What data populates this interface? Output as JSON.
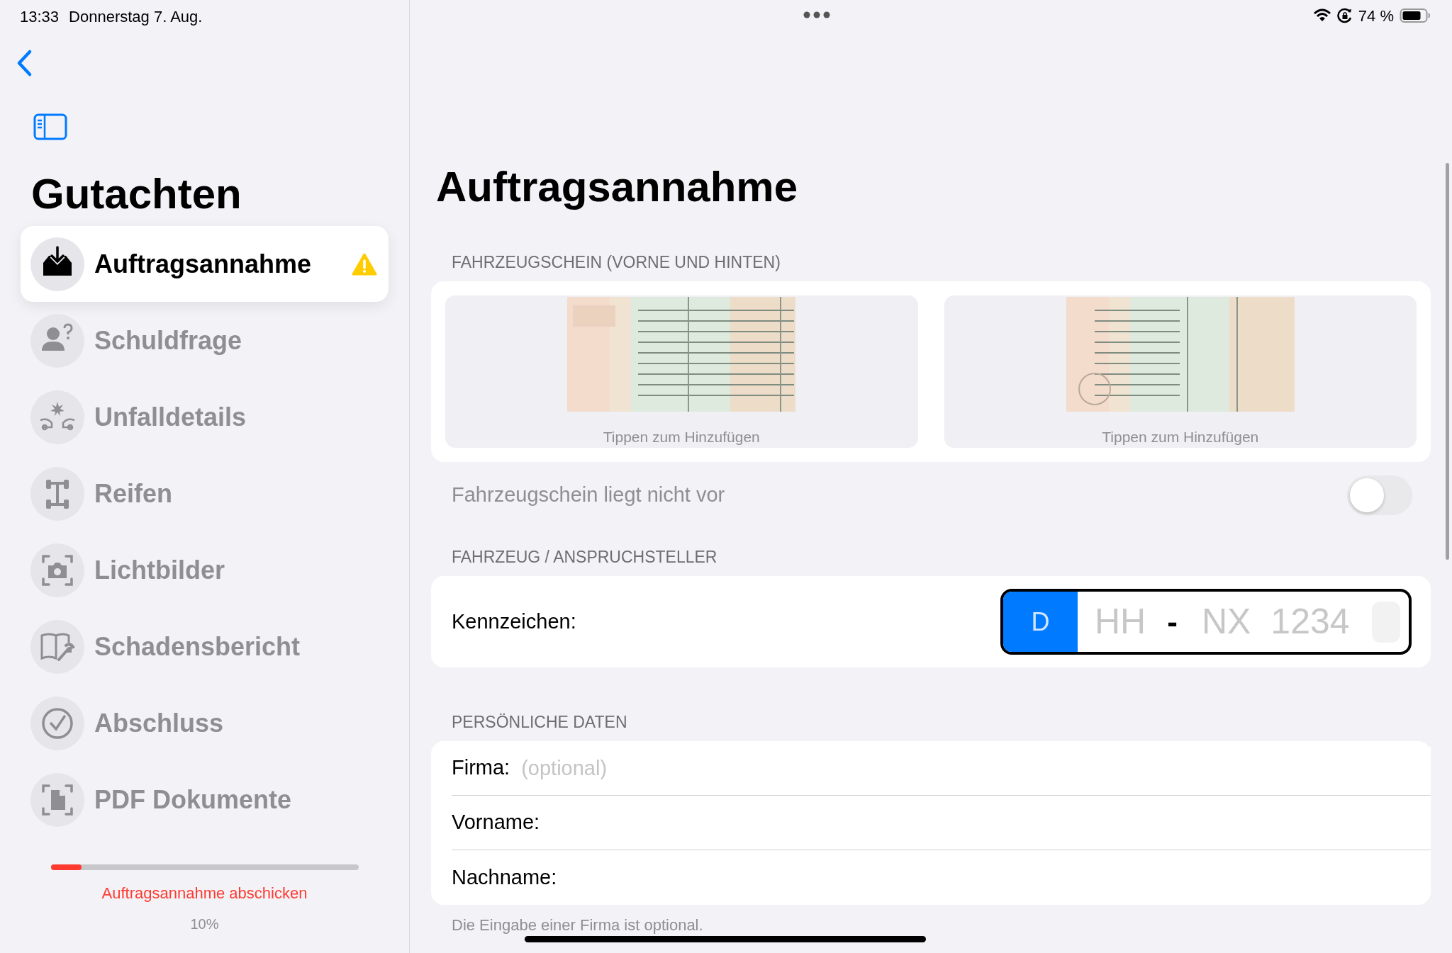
{
  "status_bar": {
    "time": "13:33",
    "date": "Donnerstag 7. Aug.",
    "battery": "74 %"
  },
  "sidebar": {
    "title": "Gutachten",
    "items": [
      {
        "label": "Auftragsannahme",
        "kind": "inbox",
        "selected": true,
        "warning": true
      },
      {
        "label": "Schuldfrage",
        "kind": "person",
        "selected": false,
        "warning": false
      },
      {
        "label": "Unfalldetails",
        "kind": "crash",
        "selected": false,
        "warning": false
      },
      {
        "label": "Reifen",
        "kind": "axle",
        "selected": false,
        "warning": false
      },
      {
        "label": "Lichtbilder",
        "kind": "camera",
        "selected": false,
        "warning": false
      },
      {
        "label": "Schadensbericht",
        "kind": "book",
        "selected": false,
        "warning": false
      },
      {
        "label": "Abschluss",
        "kind": "check",
        "selected": false,
        "warning": false
      },
      {
        "label": "PDF Dokumente",
        "kind": "document",
        "selected": false,
        "warning": false
      }
    ],
    "progress": {
      "level": 0.1,
      "action": "Auftragsannahme abschicken",
      "percent": "10%"
    }
  },
  "main": {
    "title": "Auftragsannahme",
    "sections": [
      {
        "kind": "photos",
        "header": "FAHRZEUGSCHEIN (VORNE UND HINTEN)",
        "tiles": [
          {
            "caption": "Tippen zum Hinzufügen",
            "kind": "picture"
          },
          {
            "caption": "Tippen zum Hinzufügen",
            "kind": "picture"
          }
        ],
        "toggle": {
          "label": "Fahrzeugschein liegt nicht vor",
          "on": false
        }
      },
      {
        "kind": "plate",
        "header": "FAHRZEUG / ANSPRUCHSTELLER",
        "label": "Kennzeichen:",
        "plate": {
          "country": "D",
          "district": "HH",
          "separator": "-",
          "letters": "NX",
          "numbers": "1234"
        }
      },
      {
        "kind": "fields",
        "header": "PERSÖNLICHE DATEN",
        "fields": [
          {
            "label": "Firma:",
            "placeholder": "(optional)"
          },
          {
            "label": "Vorname:"
          },
          {
            "label": "Nachname:"
          }
        ],
        "footer": "Die Eingabe einer Firma ist optional."
      }
    ]
  }
}
